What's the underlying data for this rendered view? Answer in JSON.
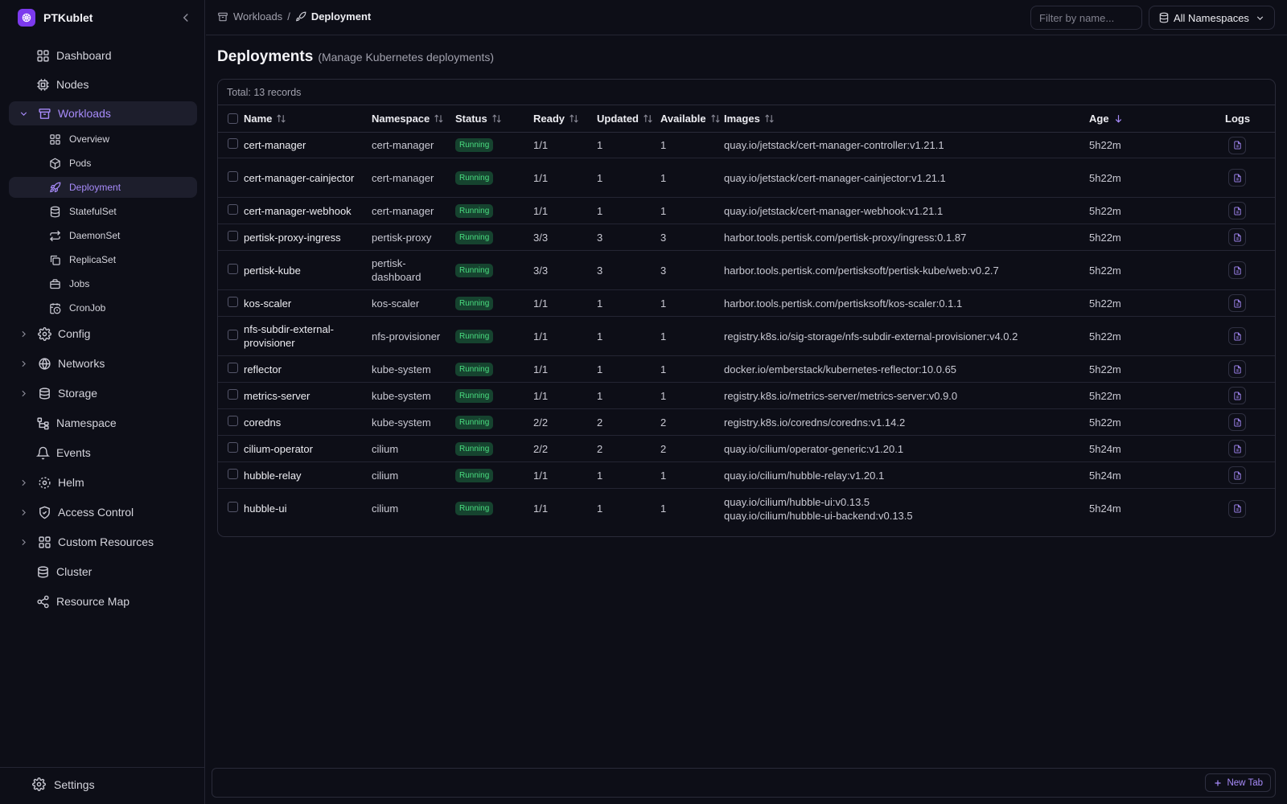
{
  "app": {
    "name": "PTKublet"
  },
  "sidebar": {
    "items": [
      {
        "label": "Dashboard",
        "icon": "dashboard-icon",
        "type": "top"
      },
      {
        "label": "Nodes",
        "icon": "cpu-icon",
        "type": "top"
      },
      {
        "label": "Workloads",
        "icon": "archive-icon",
        "type": "group",
        "expanded": true
      },
      {
        "label": "Overview",
        "icon": "grid-icon",
        "type": "sub"
      },
      {
        "label": "Pods",
        "icon": "box-icon",
        "type": "sub"
      },
      {
        "label": "Deployment",
        "icon": "rocket-icon",
        "type": "sub",
        "active": true
      },
      {
        "label": "StatefulSet",
        "icon": "database-icon",
        "type": "sub"
      },
      {
        "label": "DaemonSet",
        "icon": "repeat-icon",
        "type": "sub"
      },
      {
        "label": "ReplicaSet",
        "icon": "copy-icon",
        "type": "sub"
      },
      {
        "label": "Jobs",
        "icon": "briefcase-icon",
        "type": "sub"
      },
      {
        "label": "CronJob",
        "icon": "calendar-clock-icon",
        "type": "sub"
      },
      {
        "label": "Config",
        "icon": "gear-icon",
        "type": "group"
      },
      {
        "label": "Networks",
        "icon": "globe-icon",
        "type": "group"
      },
      {
        "label": "Storage",
        "icon": "hard-drive-icon",
        "type": "group"
      },
      {
        "label": "Namespace",
        "icon": "tree-icon",
        "type": "top"
      },
      {
        "label": "Events",
        "icon": "bell-icon",
        "type": "top"
      },
      {
        "label": "Helm",
        "icon": "helm-icon",
        "type": "group"
      },
      {
        "label": "Access Control",
        "icon": "shield-icon",
        "type": "group"
      },
      {
        "label": "Custom Resources",
        "icon": "blocks-icon",
        "type": "group"
      },
      {
        "label": "Cluster",
        "icon": "server-icon",
        "type": "top"
      },
      {
        "label": "Resource Map",
        "icon": "share-icon",
        "type": "top"
      }
    ],
    "settings_label": "Settings"
  },
  "topbar": {
    "breadcrumb_parent": "Workloads",
    "breadcrumb_sep": "/",
    "breadcrumb_current": "Deployment",
    "filter_placeholder": "Filter by name...",
    "namespace_select": "All Namespaces"
  },
  "page": {
    "title": "Deployments",
    "subtitle": "(Manage Kubernetes deployments)",
    "total_label": "Total: 13 records"
  },
  "table": {
    "columns": {
      "name": "Name",
      "namespace": "Namespace",
      "status": "Status",
      "ready": "Ready",
      "updated": "Updated",
      "available": "Available",
      "images": "Images",
      "age": "Age",
      "logs": "Logs"
    },
    "rows": [
      {
        "name": "cert-manager",
        "namespace": "cert-manager",
        "status": "Running",
        "ready": "1/1",
        "updated": "1",
        "available": "1",
        "images": [
          "quay.io/jetstack/cert-manager-controller:v1.21.1"
        ],
        "age": "5h22m"
      },
      {
        "name": "cert-manager-cainjector",
        "namespace": "cert-manager",
        "status": "Running",
        "ready": "1/1",
        "updated": "1",
        "available": "1",
        "images": [
          "quay.io/jetstack/cert-manager-cainjector:v1.21.1"
        ],
        "age": "5h22m"
      },
      {
        "name": "cert-manager-webhook",
        "namespace": "cert-manager",
        "status": "Running",
        "ready": "1/1",
        "updated": "1",
        "available": "1",
        "images": [
          "quay.io/jetstack/cert-manager-webhook:v1.21.1"
        ],
        "age": "5h22m"
      },
      {
        "name": "pertisk-proxy-ingress",
        "namespace": "pertisk-proxy",
        "status": "Running",
        "ready": "3/3",
        "updated": "3",
        "available": "3",
        "images": [
          "harbor.tools.pertisk.com/pertisk-proxy/ingress:0.1.87"
        ],
        "age": "5h22m"
      },
      {
        "name": "pertisk-kube",
        "namespace": "pertisk-dashboard",
        "status": "Running",
        "ready": "3/3",
        "updated": "3",
        "available": "3",
        "images": [
          "harbor.tools.pertisk.com/pertisksoft/pertisk-kube/web:v0.2.7"
        ],
        "age": "5h22m"
      },
      {
        "name": "kos-scaler",
        "namespace": "kos-scaler",
        "status": "Running",
        "ready": "1/1",
        "updated": "1",
        "available": "1",
        "images": [
          "harbor.tools.pertisk.com/pertisksoft/kos-scaler:0.1.1"
        ],
        "age": "5h22m"
      },
      {
        "name": "nfs-subdir-external-provisioner",
        "namespace": "nfs-provisioner",
        "status": "Running",
        "ready": "1/1",
        "updated": "1",
        "available": "1",
        "images": [
          "registry.k8s.io/sig-storage/nfs-subdir-external-provisioner:v4.0.2"
        ],
        "age": "5h22m"
      },
      {
        "name": "reflector",
        "namespace": "kube-system",
        "status": "Running",
        "ready": "1/1",
        "updated": "1",
        "available": "1",
        "images": [
          "docker.io/emberstack/kubernetes-reflector:10.0.65"
        ],
        "age": "5h22m"
      },
      {
        "name": "metrics-server",
        "namespace": "kube-system",
        "status": "Running",
        "ready": "1/1",
        "updated": "1",
        "available": "1",
        "images": [
          "registry.k8s.io/metrics-server/metrics-server:v0.9.0"
        ],
        "age": "5h22m"
      },
      {
        "name": "coredns",
        "namespace": "kube-system",
        "status": "Running",
        "ready": "2/2",
        "updated": "2",
        "available": "2",
        "images": [
          "registry.k8s.io/coredns/coredns:v1.14.2"
        ],
        "age": "5h22m"
      },
      {
        "name": "cilium-operator",
        "namespace": "cilium",
        "status": "Running",
        "ready": "2/2",
        "updated": "2",
        "available": "2",
        "images": [
          "quay.io/cilium/operator-generic:v1.20.1"
        ],
        "age": "5h24m"
      },
      {
        "name": "hubble-relay",
        "namespace": "cilium",
        "status": "Running",
        "ready": "1/1",
        "updated": "1",
        "available": "1",
        "images": [
          "quay.io/cilium/hubble-relay:v1.20.1"
        ],
        "age": "5h24m"
      },
      {
        "name": "hubble-ui",
        "namespace": "cilium",
        "status": "Running",
        "ready": "1/1",
        "updated": "1",
        "available": "1",
        "images": [
          "quay.io/cilium/hubble-ui:v0.13.5",
          "quay.io/cilium/hubble-ui-backend:v0.13.5"
        ],
        "age": "5h24m"
      }
    ]
  },
  "bottom": {
    "new_tab_label": "New Tab"
  },
  "colors": {
    "accent": "#a78bfa",
    "brand": "#7c3aed",
    "status_running_bg": "#16432f",
    "status_running_fg": "#4ade80"
  }
}
